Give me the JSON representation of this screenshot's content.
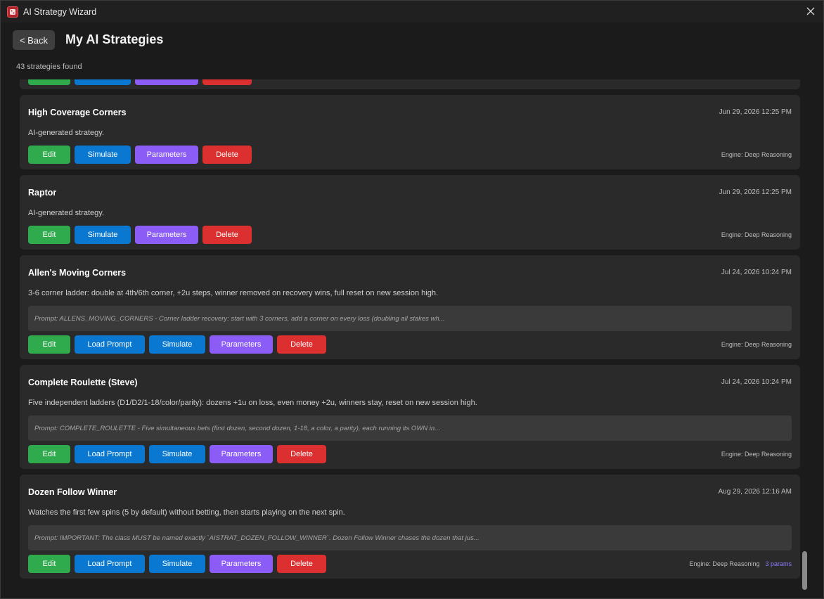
{
  "window": {
    "title": "AI Strategy Wizard"
  },
  "header": {
    "back_label": "< Back",
    "page_title": "My AI Strategies",
    "count_text": "43 strategies found"
  },
  "buttons": {
    "edit": "Edit",
    "load_prompt": "Load Prompt",
    "simulate": "Simulate",
    "parameters": "Parameters",
    "delete": "Delete"
  },
  "strategies": [
    {
      "name": "High Coverage Corners",
      "date": "Jun 29, 2026 12:25 PM",
      "description": "AI-generated strategy.",
      "engine": "Engine: Deep Reasoning"
    },
    {
      "name": "Raptor",
      "date": "Jun 29, 2026 12:25 PM",
      "description": "AI-generated strategy.",
      "engine": "Engine: Deep Reasoning"
    },
    {
      "name": "Allen's Moving Corners",
      "date": "Jul 24, 2026 10:24 PM",
      "description": "3-6 corner ladder: double at 4th/6th corner, +2u steps, winner removed on recovery wins, full reset on new session high.",
      "prompt": "Prompt: ALLENS_MOVING_CORNERS - Corner ladder recovery: start with 3 corners, add a corner on every loss (doubling all stakes wh...",
      "engine": "Engine: Deep Reasoning"
    },
    {
      "name": "Complete Roulette (Steve)",
      "date": "Jul 24, 2026 10:24 PM",
      "description": "Five independent ladders (D1/D2/1-18/color/parity): dozens +1u on loss, even money +2u, winners stay, reset on new session high.",
      "prompt": "Prompt: COMPLETE_ROULETTE - Five simultaneous bets (first dozen, second dozen, 1-18, a color, a parity), each running its OWN in...",
      "engine": "Engine: Deep Reasoning"
    },
    {
      "name": "Dozen Follow Winner",
      "date": "Aug 29, 2026 12:16 AM",
      "description": "Watches the first few spins (5 by default) without betting, then starts playing on the next spin.",
      "prompt": "Prompt: IMPORTANT: The class MUST be named exactly `AISTRAT_DOZEN_FOLLOW_WINNER`. Dozen Follow Winner chases the dozen that jus...",
      "engine": "Engine: Deep Reasoning",
      "params_badge": "3 params"
    }
  ],
  "colors": {
    "edit": "#2faa4c",
    "simulate": "#0a78d0",
    "parameters": "#8b5cf6",
    "delete": "#dc2f2f",
    "card_bg": "#2a2a2a"
  }
}
